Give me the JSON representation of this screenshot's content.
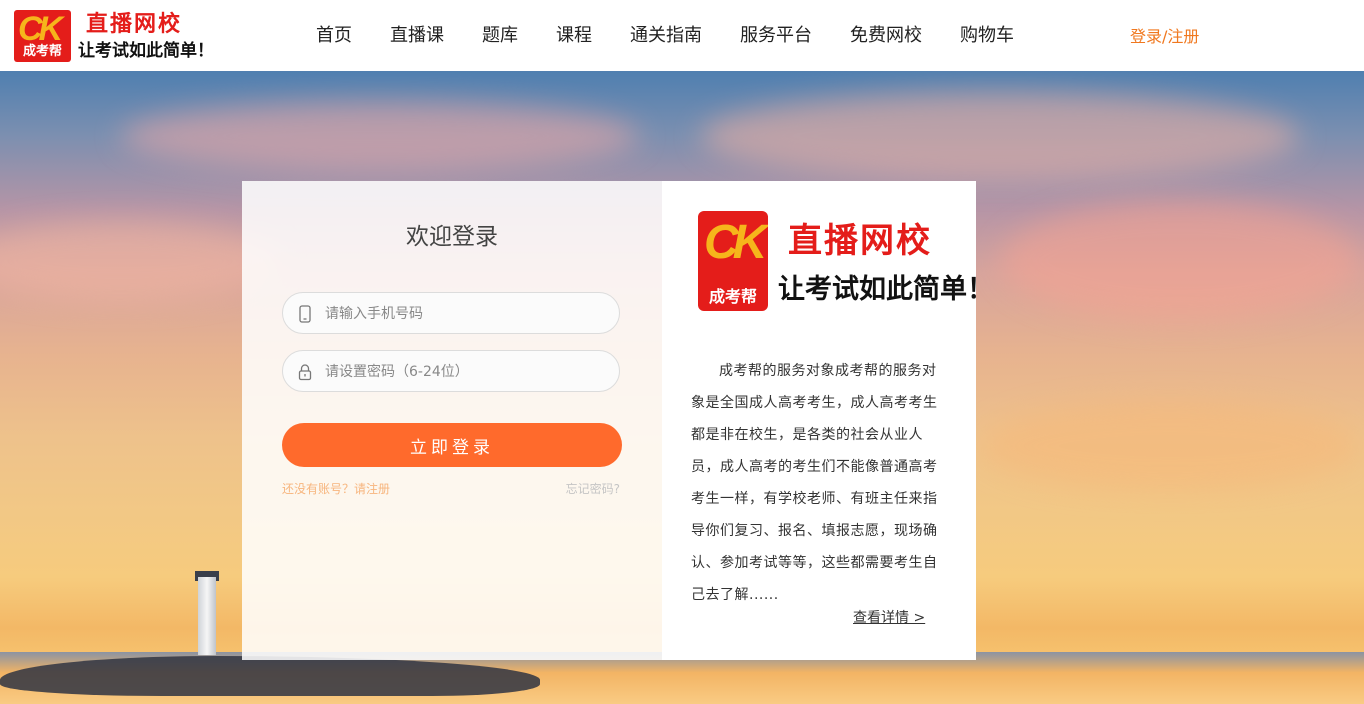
{
  "header": {
    "logo_mark_text": "成考帮",
    "logo_title": "直播网校",
    "logo_slogan": "让考试如此简单！",
    "nav": [
      {
        "label": "首页"
      },
      {
        "label": "直播课"
      },
      {
        "label": "题库"
      },
      {
        "label": "课程"
      },
      {
        "label": "通关指南"
      },
      {
        "label": "服务平台"
      },
      {
        "label": "免费网校"
      },
      {
        "label": "购物车"
      }
    ],
    "login_register": "登录/注册"
  },
  "login": {
    "title": "欢迎登录",
    "phone_placeholder": "请输入手机号码",
    "password_placeholder": "请设置密码（6-24位）",
    "submit_label": "立即登录",
    "register_link": "还没有账号？请注册",
    "forgot_link": "忘记密码?"
  },
  "brand": {
    "mark_text": "成考帮",
    "title": "直播网校",
    "slogan": "让考试如此简单！",
    "description": "成考帮的服务对象成考帮的服务对象是全国成人高考考生，成人高考考生都是非在校生，是各类的社会从业人员，成人高考的考生们不能像普通高考考生一样，有学校老师、有班主任来指导你们复习、报名、填报志愿，现场确认、参加考试等等，这些都需要考生自己去了解......",
    "more_link": "查看详情 >"
  },
  "colors": {
    "brand_red": "#e41d1a",
    "accent_orange": "#ff6a2c",
    "link_orange": "#f0781f"
  }
}
